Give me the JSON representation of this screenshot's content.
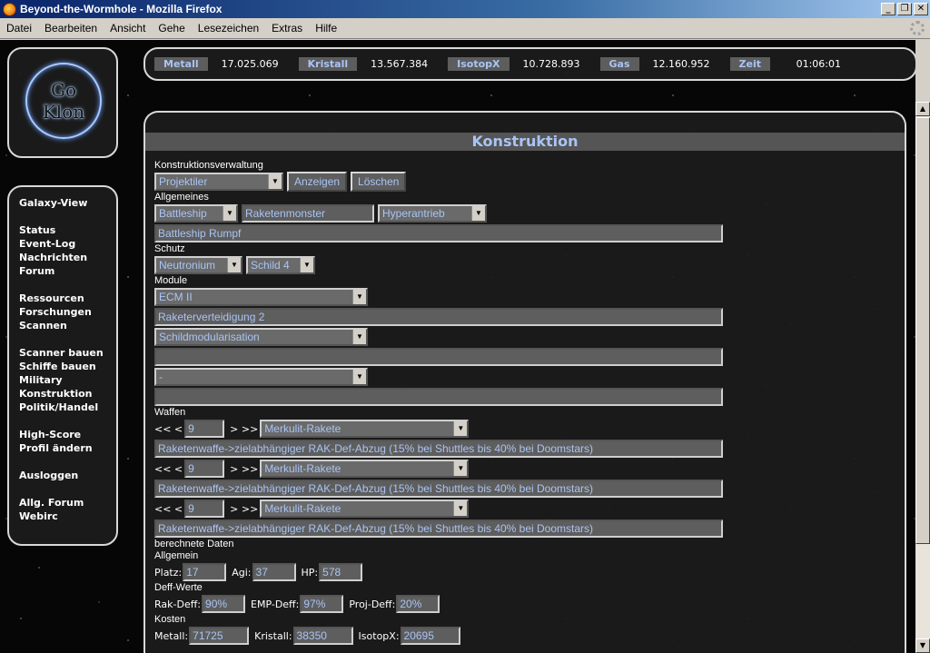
{
  "window": {
    "title": "Beyond-the-Wormhole - Mozilla Firefox",
    "buttons": [
      "_",
      "❐",
      "✕"
    ]
  },
  "menu": [
    "Datei",
    "Bearbeiten",
    "Ansicht",
    "Gehe",
    "Lesezeichen",
    "Extras",
    "Hilfe"
  ],
  "logo": {
    "line1": "Go",
    "line2": "Klon"
  },
  "nav": {
    "groups": [
      [
        "Galaxy-View"
      ],
      [
        "Status",
        "Event-Log",
        "Nachrichten",
        "Forum"
      ],
      [
        "Ressourcen",
        "Forschungen",
        "Scannen"
      ],
      [
        "Scanner bauen",
        "Schiffe bauen",
        "Military",
        "Konstruktion",
        "Politik/Handel"
      ],
      [
        "High-Score",
        "Profil ändern"
      ],
      [
        "Ausloggen"
      ],
      [
        "Allg. Forum",
        "Webirc"
      ]
    ]
  },
  "resources": [
    {
      "label": "Metall",
      "value": "17.025.069"
    },
    {
      "label": "Kristall",
      "value": "13.567.384"
    },
    {
      "label": "IsotopX",
      "value": "10.728.893"
    },
    {
      "label": "Gas",
      "value": "12.160.952"
    },
    {
      "label": "Zeit",
      "value": "01:06:01"
    }
  ],
  "main": {
    "title": "Konstruktion",
    "verwaltung_label": "Konstruktionsverwaltung",
    "projekt_select": "Projektiler",
    "anzeigen": "Anzeigen",
    "loeschen": "Löschen",
    "allgemeines_label": "Allgemeines",
    "ship_class": "Battleship",
    "ship_name": "Raketenmonster",
    "drive": "Hyperantrieb",
    "hull_desc": "Battleship Rumpf",
    "schutz_label": "Schutz",
    "armor": "Neutronium",
    "shield": "Schild 4",
    "module_label": "Module",
    "module1": "ECM II",
    "module1_desc": "Raketerverteidigung 2",
    "module2": "Schildmodularisation",
    "module2_desc": "",
    "module3": "-",
    "module3_desc": "",
    "waffen_label": "Waffen",
    "weapons": [
      {
        "left": "<< <",
        "count": "9",
        "right": "> >>",
        "name": "Merkulit-Rakete",
        "desc": "Raketenwaffe->zielabhängiger RAK-Def-Abzug (15% bei Shuttles bis 40% bei Doomstars)"
      },
      {
        "left": "<< <",
        "count": "9",
        "right": "> >>",
        "name": "Merkulit-Rakete",
        "desc": "Raketenwaffe->zielabhängiger RAK-Def-Abzug (15% bei Shuttles bis 40% bei Doomstars)"
      },
      {
        "left": "<< <",
        "count": "9",
        "right": "> >>",
        "name": "Merkulit-Rakete",
        "desc": "Raketenwaffe->zielabhängiger RAK-Def-Abzug (15% bei Shuttles bis 40% bei Doomstars)"
      }
    ],
    "calc_label": "berechnete Daten",
    "allgemein_label": "Allgemein",
    "platz_label": "Platz:",
    "platz": "17",
    "agi_label": "Agi:",
    "agi": "37",
    "hp_label": "HP:",
    "hp": "578",
    "deff_label": "Deff-Werte",
    "rak_label": "Rak-Deff:",
    "rak": "90%",
    "emp_label": "EMP-Deff:",
    "emp": "97%",
    "proj_label": "Proj-Deff:",
    "proj": "20%",
    "kosten_label": "Kosten",
    "metall_label": "Metall:",
    "metall": "71725",
    "kristall_label": "Kristall:",
    "kristall": "38350",
    "isotop_label": "IsotopX:",
    "isotop": "20695"
  },
  "scrollbar": {
    "up": "▲",
    "down": "▼"
  }
}
